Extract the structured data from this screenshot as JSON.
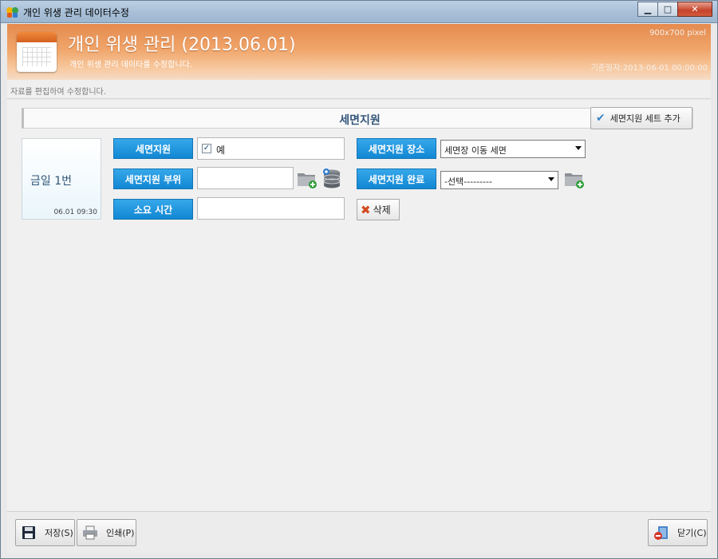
{
  "window": {
    "title": "개인 위생 관리 데이터수정",
    "min_glyph": "▁",
    "max_glyph": "□",
    "close_glyph": "✕"
  },
  "header": {
    "title": "개인 위생 관리 (2013.06.01)",
    "subtitle": "개인 위생 관리 데이타를 수정합니다.",
    "pixel_note": "900x700 pixel",
    "base_date": "기준일자:2013-06-01 00:00:00"
  },
  "status": {
    "text": "자료를 편집하여 수정합니다."
  },
  "section": {
    "title": "세면지원",
    "add_set_label": "세면지원 세트 추가"
  },
  "day_card": {
    "title": "금일 1번",
    "time": "06.01 09:30"
  },
  "form": {
    "support_label": "세면지원",
    "support_checked": true,
    "support_check_glyph": "✓",
    "support_value": "예",
    "part_label": "세면지원 부위",
    "part_value": "",
    "duration_label": "소요 시간",
    "duration_value": "",
    "place_label": "세면지원 장소",
    "place_value": "세면장 이동 세면",
    "complete_label": "세면지원 완료",
    "complete_value": "-선택---------",
    "delete_label": "삭제"
  },
  "footer": {
    "save_label": "저장(S)",
    "print_label": "인쇄(P)",
    "close_label": "닫기(C)"
  },
  "colors": {
    "header_orange": "#e48a4f",
    "label_blue": "#1287d3",
    "titlebar": "#a7bfd7"
  },
  "icons": [
    "app-icon",
    "calendar-icon",
    "check-icon",
    "folder-add-icon",
    "database-icon",
    "delete-x-icon",
    "floppy-save-icon",
    "printer-icon",
    "close-door-icon"
  ]
}
